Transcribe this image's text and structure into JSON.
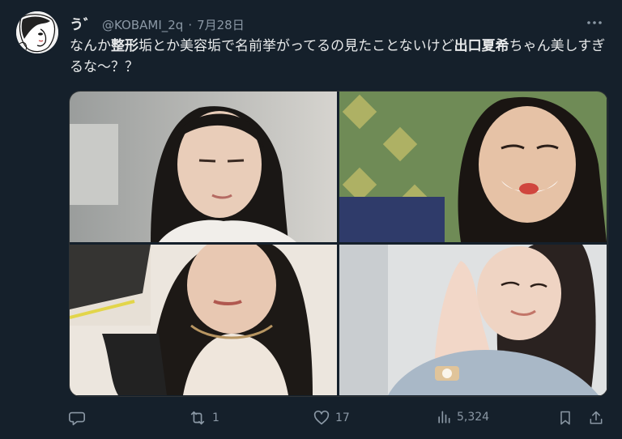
{
  "author": {
    "display_name": "う゛",
    "handle": "@KOBAMI_2q",
    "separator": "·",
    "date": "7月28日"
  },
  "tweet": {
    "text_part1": "なんか",
    "text_bold1": "整形",
    "text_part2": "垢とか美容垢で名前挙がってるの見たことないけど",
    "text_bold2": "出口夏希",
    "text_part3": "ちゃん美しすぎるな〜？？"
  },
  "media": {
    "photos": [
      "photo-1",
      "photo-2",
      "photo-3",
      "photo-4"
    ]
  },
  "actions": {
    "reply_count": "",
    "retweet_count": "1",
    "like_count": "17",
    "views_count": "5,324"
  },
  "icons": {
    "reply": "reply-icon",
    "retweet": "retweet-icon",
    "like": "heart-icon",
    "views": "views-icon",
    "bookmark": "bookmark-icon",
    "share": "share-icon",
    "more": "more-icon"
  },
  "colors": {
    "background": "#15202b",
    "text": "#e7e9ea",
    "secondary": "#8b98a5"
  }
}
